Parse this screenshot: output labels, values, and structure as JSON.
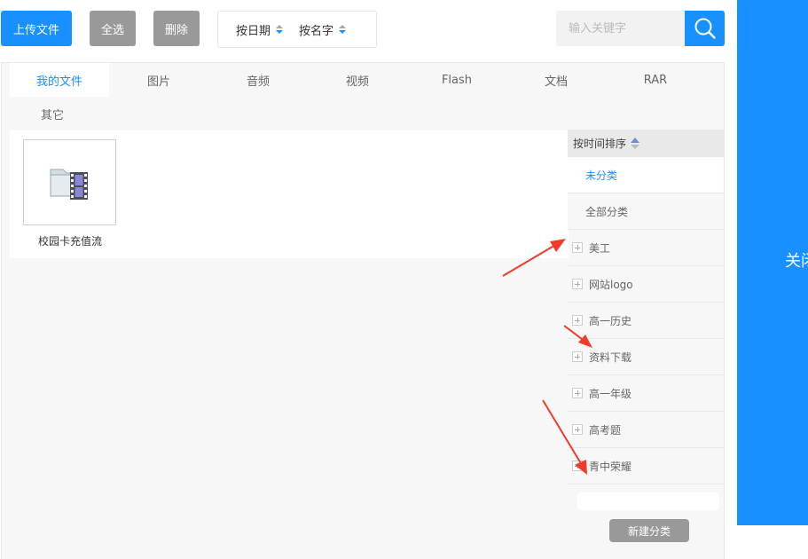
{
  "toolbar": {
    "upload_label": "上传文件",
    "select_all_label": "全选",
    "delete_label": "删除",
    "sort_by_date_label": "按日期",
    "sort_by_name_label": "按名字",
    "search_placeholder": "输入关键字",
    "accent_color": "#1890ff"
  },
  "tabs": [
    {
      "label": "我的文件",
      "active": true
    },
    {
      "label": "图片"
    },
    {
      "label": "音频"
    },
    {
      "label": "视频"
    },
    {
      "label": "Flash"
    },
    {
      "label": "文档"
    },
    {
      "label": "RAR"
    },
    {
      "label": "其它"
    }
  ],
  "files": [
    {
      "name": "校园卡充值流",
      "icon": "video-folder-icon"
    }
  ],
  "sidebar": {
    "sort_label": "按时间排序",
    "categories": [
      {
        "label": "未分类",
        "selected": true
      },
      {
        "label": "全部分类"
      },
      {
        "label": "美工",
        "expandable": true
      },
      {
        "label": "网站logo",
        "expandable": true
      },
      {
        "label": "高一历史",
        "expandable": true
      },
      {
        "label": "资料下载",
        "expandable": true
      },
      {
        "label": "高一年级",
        "expandable": true
      },
      {
        "label": "高考题",
        "expandable": true
      },
      {
        "label": "青中荣耀",
        "expandable": true
      }
    ],
    "new_category_label": "新建分类"
  },
  "close_label": "关闭"
}
